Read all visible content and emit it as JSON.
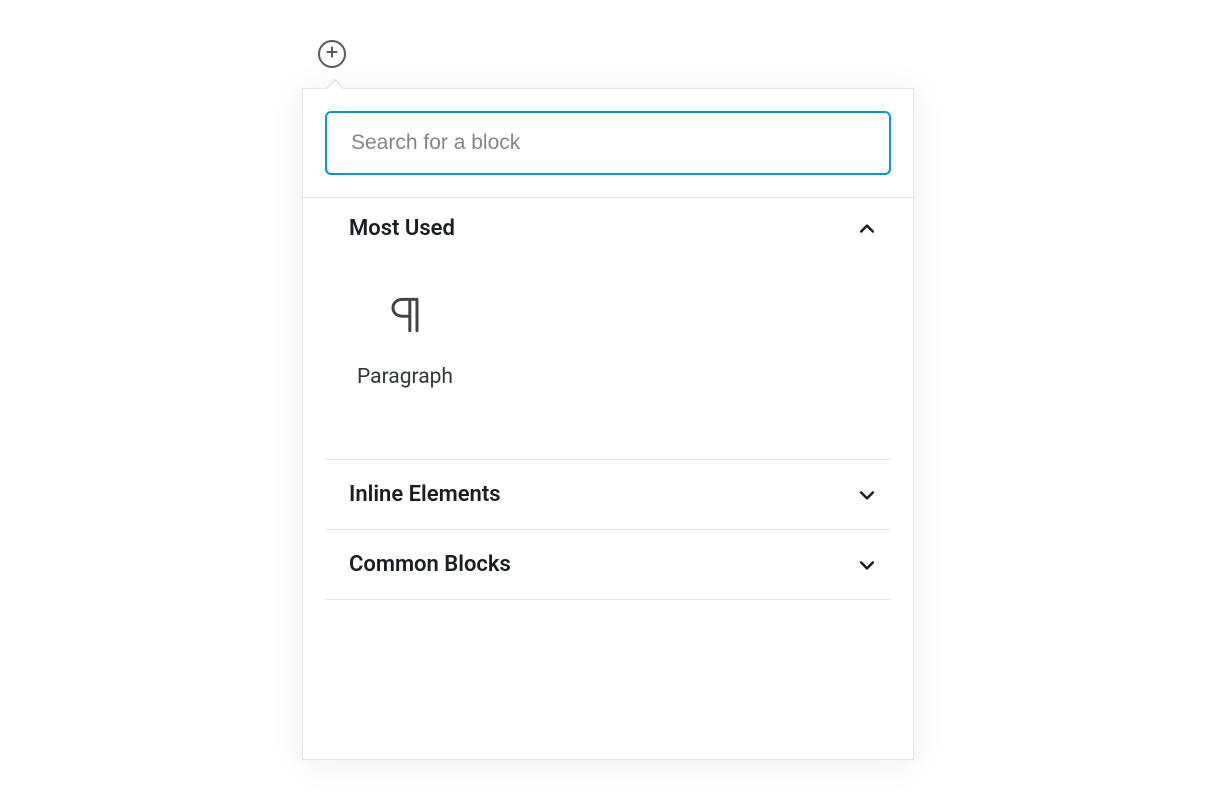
{
  "search": {
    "placeholder": "Search for a block",
    "value": ""
  },
  "sections": [
    {
      "title": "Most Used",
      "expanded": true
    },
    {
      "title": "Inline Elements",
      "expanded": false
    },
    {
      "title": "Common Blocks",
      "expanded": false
    }
  ],
  "most_used_blocks": [
    {
      "name": "Paragraph",
      "icon": "paragraph-icon"
    }
  ]
}
